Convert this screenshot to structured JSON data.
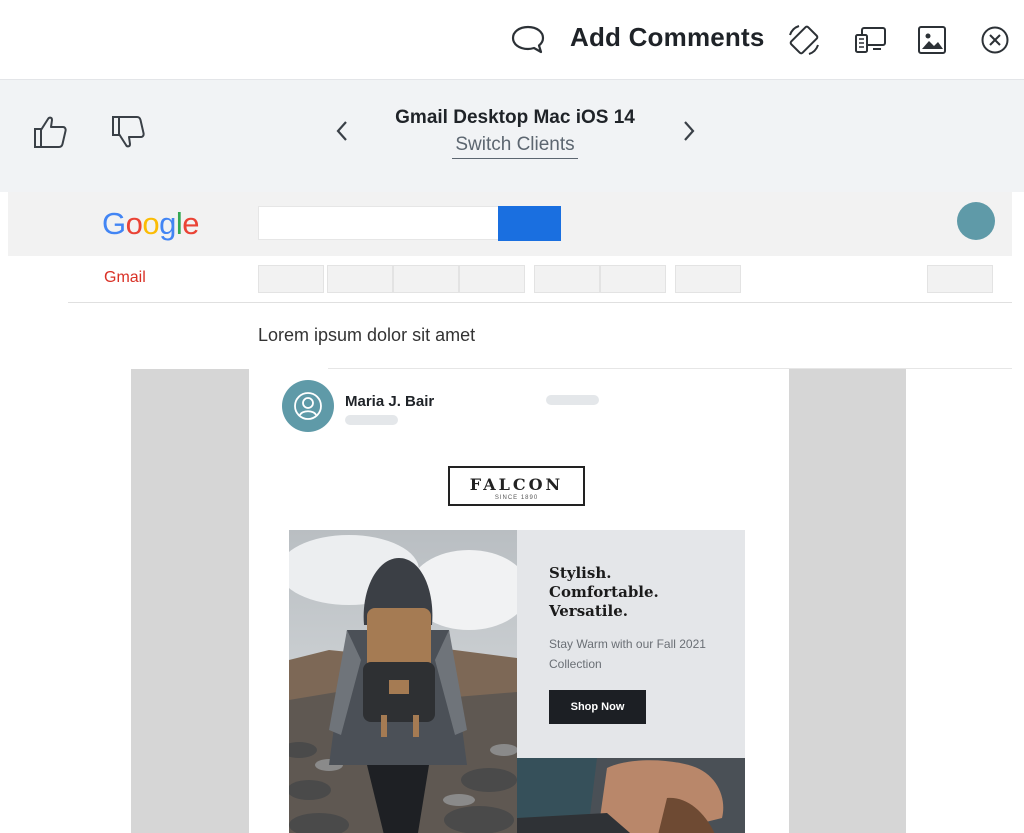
{
  "toolbar": {
    "title": "Add Comments",
    "icons": [
      "comment-icon",
      "rotate-icon",
      "devices-icon",
      "image-icon",
      "close-icon"
    ]
  },
  "client_bar": {
    "client_name": "Gmail Desktop Mac iOS 14",
    "switch_label": "Switch Clients"
  },
  "gmail": {
    "logo": "Google",
    "label": "Gmail",
    "subject": "Lorem ipsum dolor sit amet",
    "accent_color": "#1a6fe0"
  },
  "email": {
    "sender": "Maria J. Bair",
    "brand": "FALCON",
    "brand_since": "SINCE 1890",
    "headline": [
      "Stylish.",
      "Comfortable.",
      "Versatile."
    ],
    "subheading": "Stay Warm with our Fall 2021 Collection",
    "cta": "Shop Now"
  }
}
